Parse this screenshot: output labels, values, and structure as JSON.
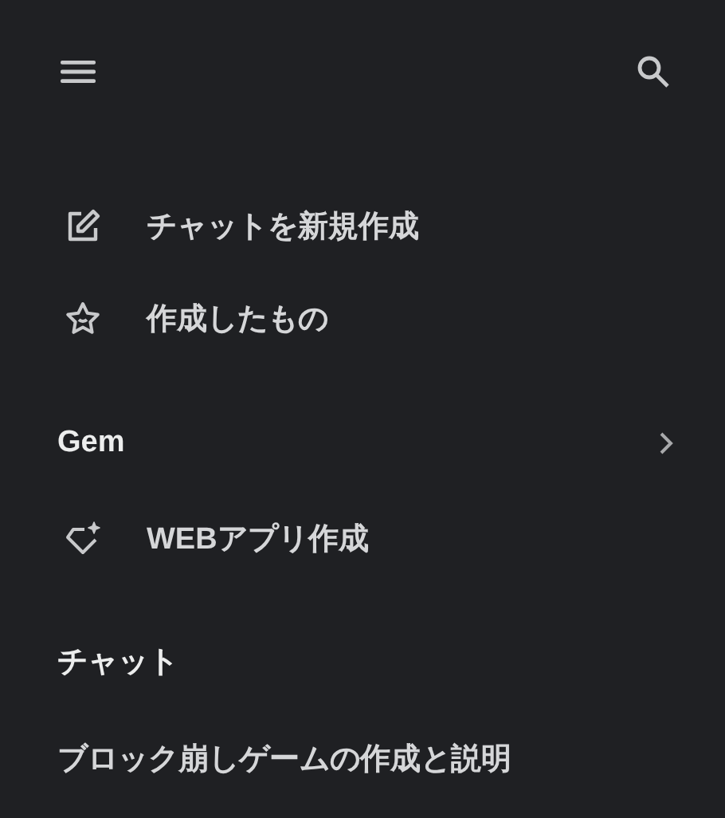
{
  "actions": [
    {
      "kind": "edit",
      "label": "チャットを新規作成"
    },
    {
      "kind": "star",
      "label": "作成したもの"
    }
  ],
  "gem_section": {
    "title": "Gem",
    "expandable": true,
    "items": [
      {
        "kind": "gem",
        "label": "WEBアプリ作成"
      }
    ]
  },
  "chat_section": {
    "title": "チャット",
    "items": [
      {
        "label": "ブロック崩しゲームの作成と説明"
      }
    ]
  }
}
